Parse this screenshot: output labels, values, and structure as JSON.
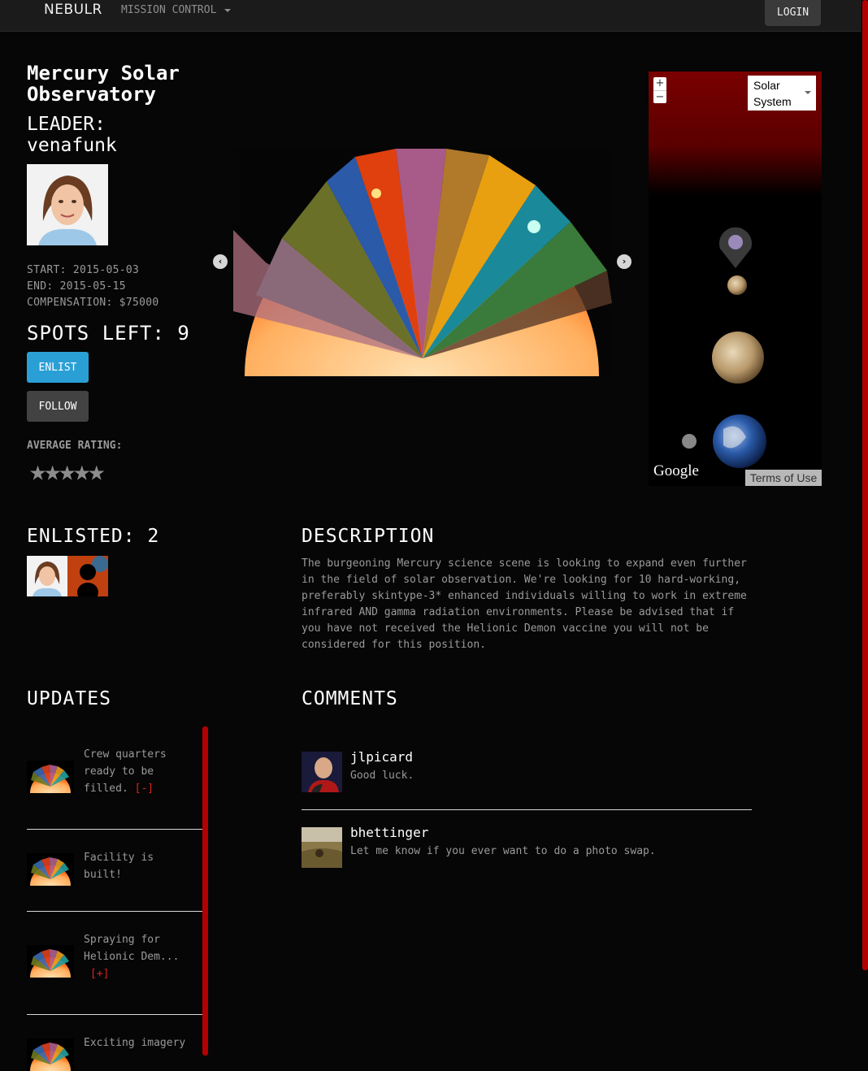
{
  "nav": {
    "brand": "NEBULR",
    "mission_control": "MISSION CONTROL",
    "login": "LOGIN"
  },
  "mission": {
    "title": "Mercury Solar Observatory",
    "leader_label": "LEADER:",
    "leader_name": "venafunk",
    "start": "START: 2015-05-03",
    "end": "END: 2015-05-15",
    "compensation": "COMPENSATION: $75000",
    "spots_left": "SPOTS LEFT: 9",
    "enlist_label": "ENLIST",
    "follow_label": "FOLLOW",
    "rating_label": "AVERAGE RATING:",
    "rating_stars": "★★★★★"
  },
  "map": {
    "zoom_in": "+",
    "zoom_out": "−",
    "layer_select": "Solar System",
    "brand": "Google",
    "terms": "Terms of Use"
  },
  "enlisted": {
    "heading": "ENLISTED: 2"
  },
  "description": {
    "heading": "DESCRIPTION",
    "text": "The burgeoning Mercury science scene is looking to expand even further in the field of solar observation. We're looking for 10 hard-working, preferably skintype-3* enhanced individuals willing to work in extreme infrared AND gamma radiation environments. Please be advised that if you have not received the Helionic Demon vaccine you will not be considered for this position."
  },
  "updates": {
    "heading": "UPDATES",
    "items": [
      {
        "text": "Crew quarters ready to be filled.",
        "toggle": "[-]"
      },
      {
        "text": "Facility is built!",
        "toggle": ""
      },
      {
        "text": "Spraying for Helionic Dem...",
        "toggle": "[+]"
      },
      {
        "text": "Exciting imagery",
        "toggle": ""
      }
    ]
  },
  "comments": {
    "heading": "COMMENTS",
    "items": [
      {
        "user": "jlpicard",
        "text": "Good luck."
      },
      {
        "user": "bhettinger",
        "text": "Let me know if you ever want to do a photo swap."
      }
    ]
  },
  "colors": {
    "accent_blue": "#2a9fd6",
    "scroll_red": "#b30000",
    "toggle_red": "#e02020"
  }
}
